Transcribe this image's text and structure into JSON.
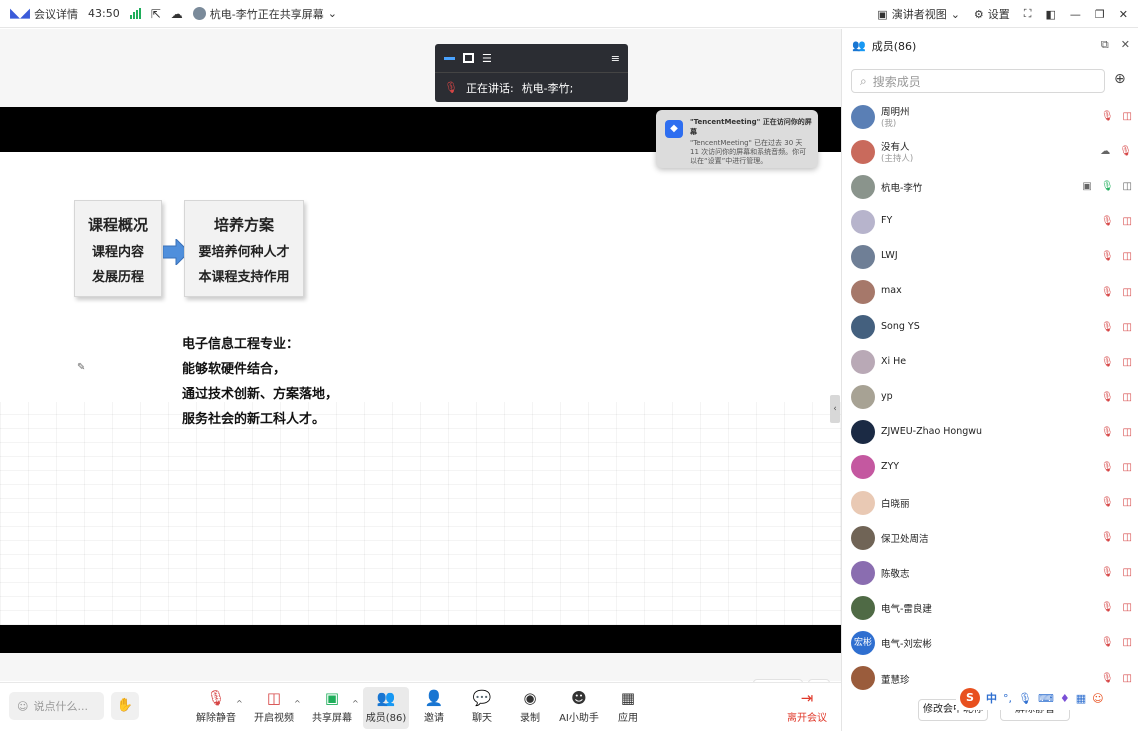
{
  "topbar": {
    "meeting_details": "会议详情",
    "timer": "43:50",
    "sharing_status": "杭电-李竹正在共享屏幕",
    "presenter_view": "演讲者视图",
    "settings": "设置"
  },
  "speaking": {
    "label": "正在讲话:",
    "name": "杭电-李竹;"
  },
  "notification": {
    "title": "\"TencentMeeting\" 正在访问你的屏幕",
    "body": "\"TencentMeeting\" 已在过去 30 天 11 次访问你的屏幕和系统音频。你可以在“设置”中进行管理。"
  },
  "slide": {
    "box1": {
      "title": "课程概况",
      "line1": "课程内容",
      "line2": "发展历程"
    },
    "box2": {
      "title": "培养方案",
      "line1": "要培养何种人才",
      "line2": "本课程支持作用"
    },
    "desc": [
      "电子信息工程专业：",
      "能够软硬件结合，",
      "通过技术创新、方案落地，",
      "服务社会的新工科人才。"
    ]
  },
  "stage_controls": {
    "annotate": "批注"
  },
  "toolbar": {
    "chat_placeholder": "说点什么...",
    "unmute": "解除静音",
    "start_video": "开启视频",
    "share_screen": "共享屏幕",
    "members": "成员(86)",
    "invite": "邀请",
    "chat": "聊天",
    "record": "录制",
    "ai_assistant": "AI小助手",
    "apps": "应用",
    "leave": "离开会议"
  },
  "panel": {
    "title": "成员(86)",
    "search_placeholder": "搜索成员",
    "members": [
      {
        "name": "周明州",
        "sub": "(我)"
      },
      {
        "name": "没有人",
        "sub": "(主持人)"
      },
      {
        "name": "杭电-李竹",
        "sub": ""
      },
      {
        "name": "FY",
        "sub": ""
      },
      {
        "name": "LWJ",
        "sub": ""
      },
      {
        "name": "max",
        "sub": ""
      },
      {
        "name": "Song YS",
        "sub": ""
      },
      {
        "name": "Xi He",
        "sub": ""
      },
      {
        "name": "yp",
        "sub": ""
      },
      {
        "name": "ZJWEU-Zhao Hongwu",
        "sub": ""
      },
      {
        "name": "ZYY",
        "sub": ""
      },
      {
        "name": "白晓丽",
        "sub": ""
      },
      {
        "name": "保卫处周洁",
        "sub": ""
      },
      {
        "name": "陈敬志",
        "sub": ""
      },
      {
        "name": "电气-雷良建",
        "sub": ""
      },
      {
        "name": "电气-刘宏彬",
        "sub": "",
        "avatar_text": "宏彬"
      },
      {
        "name": "董慧珍",
        "sub": ""
      }
    ],
    "footer": {
      "rename": "修改会中昵称",
      "unmute_all": "解除静音"
    }
  },
  "ime": {
    "s": "S",
    "lang": "中"
  }
}
